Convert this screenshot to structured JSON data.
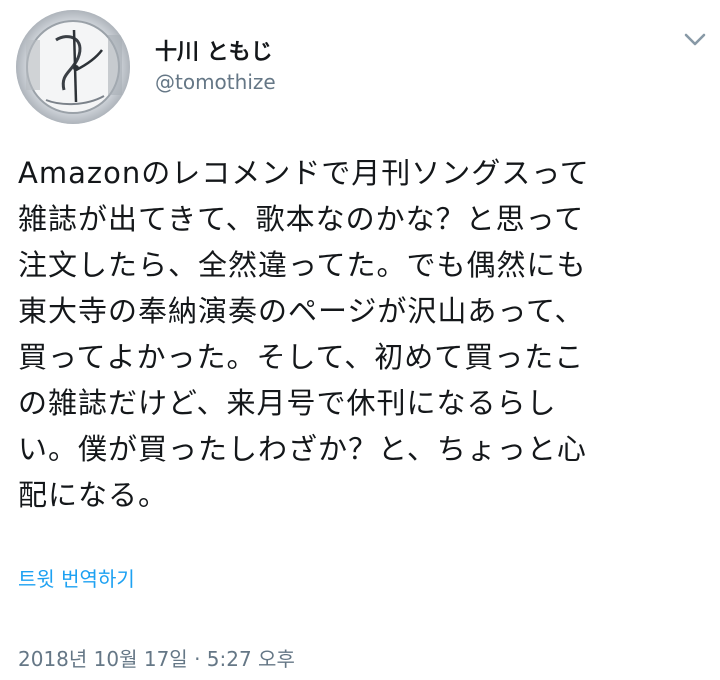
{
  "author": {
    "display_name": "十川 ともじ",
    "handle": "@tomothize",
    "avatar_icon": "clock-avatar-icon"
  },
  "menu": {
    "icon": "chevron-down-icon"
  },
  "tweet": {
    "text": "Amazonのレコメンドで月刊ソングスって\n雑誌が出てきて、歌本なのかな？と思って\n注文したら、全然違ってた。でも偶然にも\n東大寺の奉納演奏のページが沢山あって、\n買ってよかった。そして、初めて買ったこ\nの雑誌だけど、来月号で休刊になるらし\nい。僕が買ったしわざか？と、ちょっと心\n配になる。",
    "translate_label": "트윗 번역하기",
    "timestamp": "2018년 10월 17일 · 5:27 오후"
  },
  "colors": {
    "text": "#14171a",
    "secondary": "#657786",
    "link": "#1da1f2"
  }
}
